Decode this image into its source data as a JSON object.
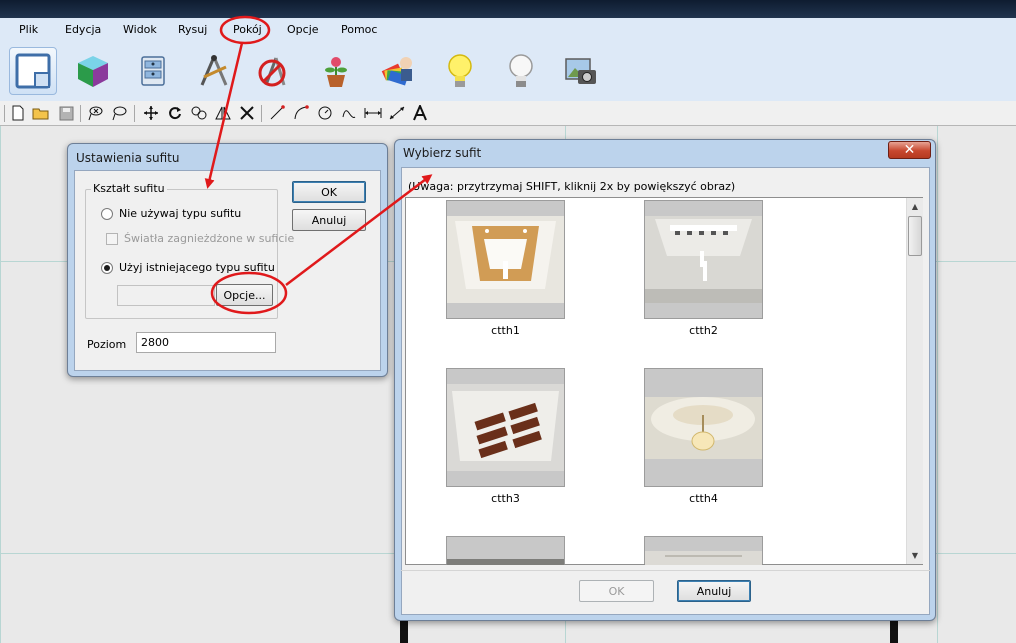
{
  "menu": {
    "items": [
      "Plik",
      "Edycja",
      "Widok",
      "Rysuj",
      "Pokój",
      "Opcje",
      "Pomoc"
    ]
  },
  "ribbon": {
    "icons": [
      "floor-plan-icon",
      "3d-cube-icon",
      "furniture-cabinet-icon",
      "drawing-tools-icon",
      "no-drawing-icon",
      "plant-pot-icon",
      "color-palette-icon",
      "light-bulb-icon",
      "light-bulb-off-icon",
      "camera-photo-icon"
    ]
  },
  "toolbar": {
    "icons": [
      "new-file-icon",
      "open-folder-icon",
      "save-icon",
      "lasso-select-icon",
      "lasso-deselect-icon",
      "move-icon",
      "rotate-icon",
      "rotate-copy-icon",
      "mirror-icon",
      "delete-icon",
      "line-icon",
      "arc-icon",
      "circle-icon",
      "curve-icon",
      "dimension-icon",
      "diagonal-dimension-icon",
      "text-icon"
    ]
  },
  "ceiling_settings": {
    "title": "Ustawienia sufitu",
    "group_label": "Kształt sufitu",
    "option_none": "Nie używaj typu sufitu",
    "checkbox_lights": "Światła zagnieżdżone w suficie",
    "option_existing": "Użyj istniejącego typu sufitu",
    "options_button": "Opcje...",
    "ok": "OK",
    "cancel": "Anuluj",
    "level_label": "Poziom",
    "level_value": "2800"
  },
  "choose_ceiling": {
    "title": "Wybierz sufit",
    "close": "✕",
    "hint": "(Uwaga: przytrzymaj SHIFT, kliknij 2x by powiększyć obraz)",
    "items": [
      "ctth1",
      "ctth2",
      "ctth3",
      "ctth4"
    ],
    "ok": "OK",
    "cancel": "Anuluj"
  },
  "colors": {
    "menu_bg": "#dde9f7",
    "annotation_red": "#e0191b",
    "grid_line": "#b8d6d3"
  }
}
